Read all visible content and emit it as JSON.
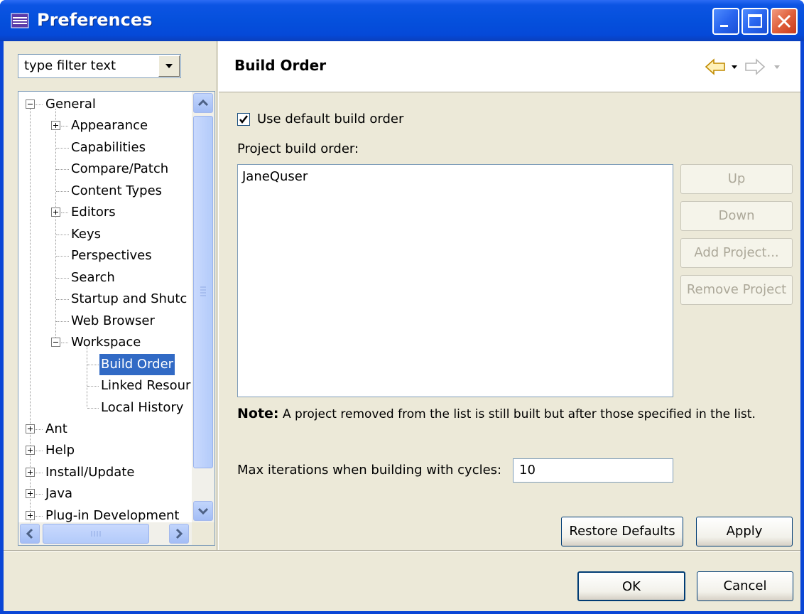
{
  "window": {
    "title": "Preferences"
  },
  "filter": {
    "placeholder": "type filter text"
  },
  "tree": {
    "items": [
      {
        "label": "General",
        "expanded": true
      },
      {
        "label": "Appearance",
        "expandable": true
      },
      {
        "label": "Capabilities"
      },
      {
        "label": "Compare/Patch"
      },
      {
        "label": "Content Types"
      },
      {
        "label": "Editors",
        "expandable": true
      },
      {
        "label": "Keys"
      },
      {
        "label": "Perspectives"
      },
      {
        "label": "Search"
      },
      {
        "label": "Startup and Shutc"
      },
      {
        "label": "Web Browser"
      },
      {
        "label": "Workspace",
        "expanded": true
      },
      {
        "label": "Build Order",
        "selected": true
      },
      {
        "label": "Linked Resour"
      },
      {
        "label": "Local History"
      },
      {
        "label": "Ant",
        "expandable": true
      },
      {
        "label": "Help",
        "expandable": true
      },
      {
        "label": "Install/Update",
        "expandable": true
      },
      {
        "label": "Java",
        "expandable": true
      },
      {
        "label": "Plug-in Development",
        "expandable": true
      }
    ]
  },
  "page": {
    "title": "Build Order",
    "use_default_label": "Use default build order",
    "use_default_checked": true,
    "project_build_order_label": "Project build order:",
    "projects": [
      "JaneQuser"
    ],
    "buttons": {
      "up": "Up",
      "down": "Down",
      "add_project": "Add Project...",
      "remove_project": "Remove Project",
      "restore_defaults": "Restore Defaults",
      "apply": "Apply"
    },
    "note_label": "Note:",
    "note_text": "A project removed from the list is still built but after those specified in the list.",
    "max_iterations_label": "Max iterations when building with cycles:",
    "max_iterations_value": "10"
  },
  "dialog_buttons": {
    "ok": "OK",
    "cancel": "Cancel"
  },
  "colors": {
    "titlebar": "#0550dc",
    "selection": "#316ac5",
    "face": "#ece9d8"
  }
}
